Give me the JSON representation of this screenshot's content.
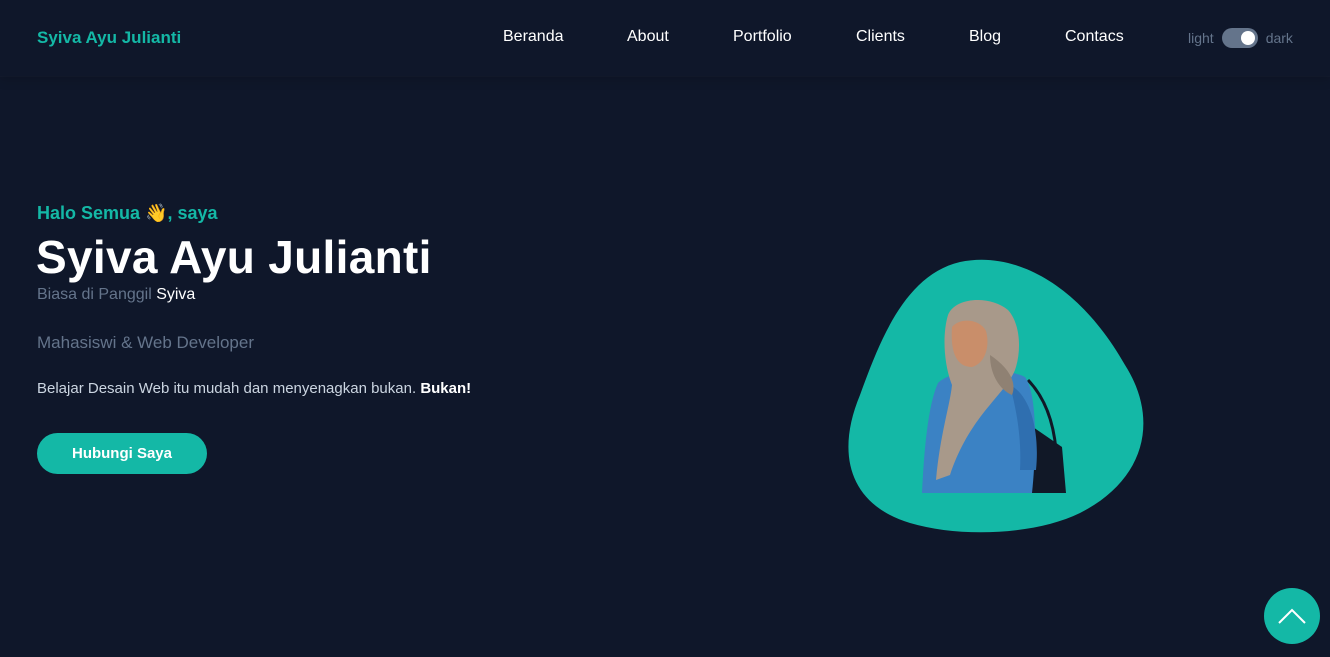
{
  "header": {
    "brand": "Syiva Ayu Julianti",
    "nav": [
      "Beranda",
      "About",
      "Portfolio",
      "Clients",
      "Blog",
      "Contacs"
    ],
    "theme": {
      "light_label": "light",
      "dark_label": "dark",
      "dark_enabled": true
    }
  },
  "hero": {
    "greeting": "Halo Semua 👋, saya",
    "name": "Syiva Ayu Julianti",
    "nickname_prefix": "Biasa di Panggil",
    "nickname": "Syiva",
    "role": "Mahasiswi & Web Developer",
    "tagline": "Belajar Desain Web itu mudah dan menyenagkan bukan.",
    "tagline_emphasis": "Bukan!",
    "cta_label": "Hubungi Saya"
  },
  "colors": {
    "background": "#0f172a",
    "accent": "#14b8a6",
    "muted": "#64748b"
  },
  "icons": {
    "back_to_top": "chevron-up-icon",
    "profile_blob": "profile-photo"
  }
}
